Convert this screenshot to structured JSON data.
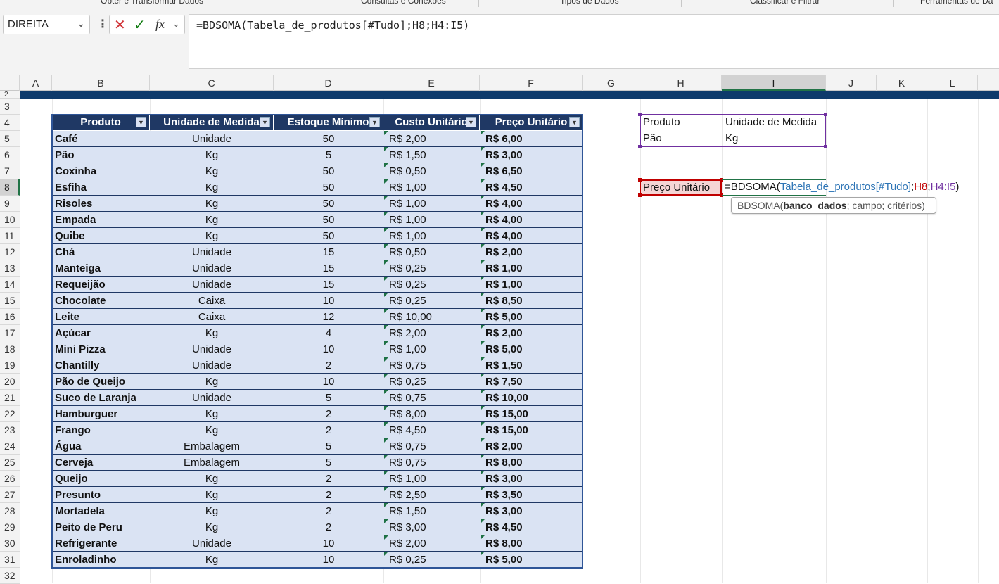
{
  "ribbon_groups": [
    "Obter e Transformar Dados",
    "Consultas e Conexões",
    "Tipos de Dados",
    "Classificar e Filtrar",
    "Ferramentas de Da"
  ],
  "name_box": "DIREITA",
  "formula_bar": {
    "text": "=BDSOMA(Tabela_de_produtos[#Tudo];H8;H4:I5)",
    "cancel_glyph": "✕",
    "enter_glyph": "✓",
    "fx_glyph": "fx"
  },
  "columns": [
    "A",
    "B",
    "C",
    "D",
    "E",
    "F",
    "G",
    "H",
    "I",
    "J",
    "K",
    "L"
  ],
  "rows": [
    "2",
    "3",
    "4",
    "5",
    "6",
    "7",
    "8",
    "9",
    "10",
    "11",
    "12",
    "13",
    "14",
    "15",
    "16",
    "17",
    "18",
    "19",
    "20",
    "21",
    "22",
    "23",
    "24",
    "25",
    "26",
    "27",
    "28",
    "29",
    "30",
    "31",
    "32"
  ],
  "selected_column": "I",
  "selected_row": "8",
  "table": {
    "headers": [
      "Produto",
      "Unidade de Medida",
      "Estoque Mínimo",
      "Custo Unitário",
      "Preço Unitário"
    ],
    "rows": [
      [
        "Café",
        "Unidade",
        "50",
        "R$ 2,00",
        "R$ 6,00"
      ],
      [
        "Pão",
        "Kg",
        "5",
        "R$ 1,50",
        "R$ 3,00"
      ],
      [
        "Coxinha",
        "Kg",
        "50",
        "R$ 0,50",
        "R$ 6,50"
      ],
      [
        "Esfiha",
        "Kg",
        "50",
        "R$ 1,00",
        "R$ 4,50"
      ],
      [
        "Risoles",
        "Kg",
        "50",
        "R$ 1,00",
        "R$ 4,00"
      ],
      [
        "Empada",
        "Kg",
        "50",
        "R$ 1,00",
        "R$ 4,00"
      ],
      [
        "Quibe",
        "Kg",
        "50",
        "R$ 1,00",
        "R$ 4,00"
      ],
      [
        "Chá",
        "Unidade",
        "15",
        "R$ 0,50",
        "R$ 2,00"
      ],
      [
        "Manteiga",
        "Unidade",
        "15",
        "R$ 0,25",
        "R$ 1,00"
      ],
      [
        "Requeijão",
        "Unidade",
        "15",
        "R$ 0,25",
        "R$ 1,00"
      ],
      [
        "Chocolate",
        "Caixa",
        "10",
        "R$ 0,25",
        "R$ 8,50"
      ],
      [
        "Leite",
        "Caixa",
        "12",
        "R$ 10,00",
        "R$ 5,00"
      ],
      [
        "Açúcar",
        "Kg",
        "4",
        "R$ 2,00",
        "R$ 2,00"
      ],
      [
        "Mini Pizza",
        "Unidade",
        "10",
        "R$ 1,00",
        "R$ 5,00"
      ],
      [
        "Chantilly",
        "Unidade",
        "2",
        "R$ 0,75",
        "R$ 1,50"
      ],
      [
        "Pão de Queijo",
        "Kg",
        "10",
        "R$ 0,25",
        "R$ 7,50"
      ],
      [
        "Suco de Laranja",
        "Unidade",
        "5",
        "R$ 0,75",
        "R$ 10,00"
      ],
      [
        "Hamburguer",
        "Kg",
        "2",
        "R$ 8,00",
        "R$ 15,00"
      ],
      [
        "Frango",
        "Kg",
        "2",
        "R$ 4,50",
        "R$ 15,00"
      ],
      [
        "Água",
        "Embalagem",
        "5",
        "R$ 0,75",
        "R$ 2,00"
      ],
      [
        "Cerveja",
        "Embalagem",
        "5",
        "R$ 0,75",
        "R$ 8,00"
      ],
      [
        "Queijo",
        "Kg",
        "2",
        "R$ 1,00",
        "R$ 3,00"
      ],
      [
        "Presunto",
        "Kg",
        "2",
        "R$ 2,50",
        "R$ 3,50"
      ],
      [
        "Mortadela",
        "Kg",
        "2",
        "R$ 1,50",
        "R$ 3,00"
      ],
      [
        "Peito de Peru",
        "Kg",
        "2",
        "R$ 3,00",
        "R$ 4,50"
      ],
      [
        "Refrigerante",
        "Unidade",
        "10",
        "R$ 2,00",
        "R$ 8,00"
      ],
      [
        "Enroladinho",
        "Kg",
        "10",
        "R$ 0,25",
        "R$ 5,00"
      ]
    ]
  },
  "criteria": {
    "h4": "Produto",
    "i4": "Unidade de Medida",
    "h5": "Pão",
    "i5": "Kg"
  },
  "h8_label": "Preço Unitário",
  "edit_formula": {
    "p1": "=BDSOMA(",
    "p2": "Tabela_de_produtos[#Tudo]",
    "p3": ";",
    "p4": "H8",
    "p5": ";",
    "p6": "H4:I5",
    "p7": ")"
  },
  "tooltip": {
    "fn": "BDSOMA(",
    "arg1": "banco_dados",
    "rest": "; campo; critérios)"
  },
  "colors": {
    "table_header": "#1f3864",
    "table_band": "#dae3f3",
    "criteria_border": "#7030a0",
    "h8_border": "#c00000",
    "ref_blue": "#2e75b6",
    "ref_red": "#c00000",
    "ref_purple": "#7030a0"
  }
}
